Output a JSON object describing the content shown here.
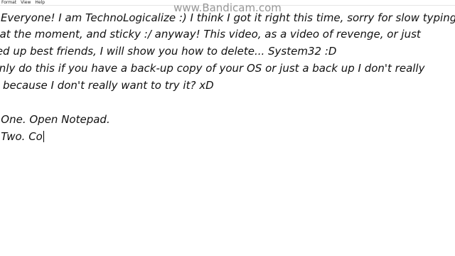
{
  "menubar": {
    "items": [
      "Format",
      "View",
      "Help"
    ]
  },
  "watermark": "www.Bandicam.com",
  "document": {
    "lines": [
      "o Everyone! I am TechnoLogicalize :) I think I got it right this time, sorry for slow typing...",
      "s at the moment, and sticky :/ anyway! This video, as a video of revenge, or just",
      "sed up best friends, I will show you how to delete... System32 :D",
      "Only do this if you have a back-up copy of your OS or just a back up I don't really",
      "w because I don't really want to try it? xD",
      "",
      "p One. Open Notepad.",
      "p Two. Co"
    ]
  }
}
